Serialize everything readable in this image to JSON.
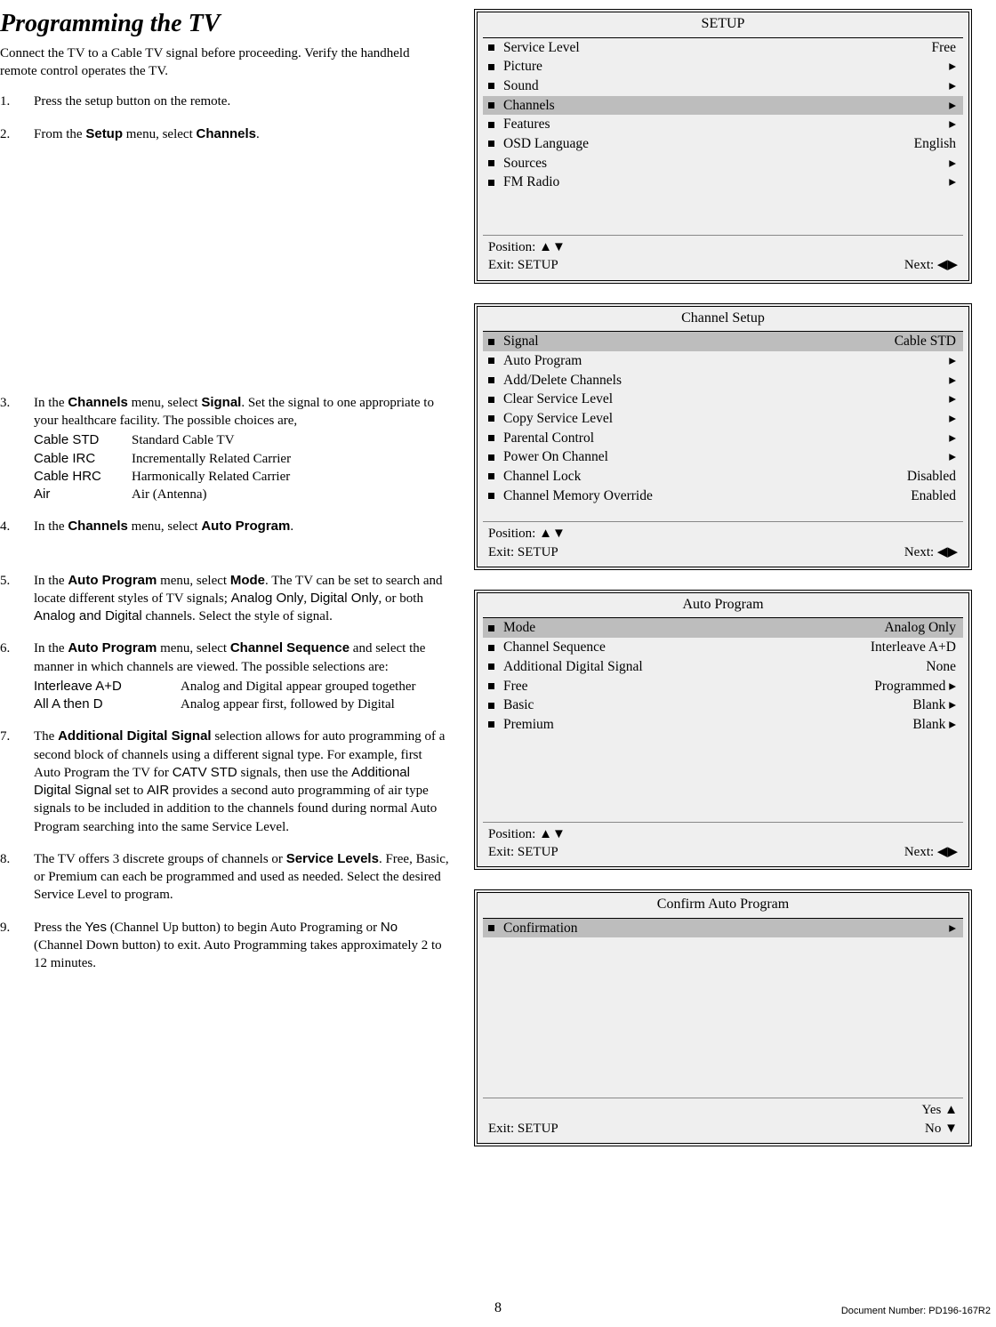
{
  "title": "Programming the TV",
  "intro": "Connect the TV to a Cable TV signal before proceeding.  Verify the handheld remote control operates the TV.",
  "steps": {
    "s1": "Press the setup button on the remote.",
    "s2a": "From the ",
    "s2b": "Setup",
    "s2c": " menu, select ",
    "s2d": "Channels",
    "s2e": ".",
    "s3a": "In the ",
    "s3b": "Channels",
    "s3c": " menu, select ",
    "s3d": "Signal",
    "s3e": ".  Set the signal to one appropriate to your healthcare facility.  The possible choices are,",
    "s3_defs": [
      {
        "t": "Cable STD",
        "d": "Standard Cable TV"
      },
      {
        "t": "Cable IRC",
        "d": "Incrementally Related Carrier"
      },
      {
        "t": "Cable HRC",
        "d": "Harmonically Related Carrier"
      },
      {
        "t": "Air",
        "d": "Air (Antenna)"
      }
    ],
    "s4a": "In the ",
    "s4b": "Channels",
    "s4c": " menu, select ",
    "s4d": "Auto Program",
    "s4e": ".",
    "s5a": "In the ",
    "s5b": "Auto Program",
    "s5c": " menu, select ",
    "s5d": "Mode",
    "s5e": ".  The TV can be set to search and locate different styles of TV signals; ",
    "s5f": "Analog Only",
    "s5g": ", ",
    "s5h": "Digital Only",
    "s5i": ", or both ",
    "s5j": "Analog and Digital",
    "s5k": " channels.  Select the style of signal.",
    "s6a": "In the ",
    "s6b": "Auto Program",
    "s6c": " menu, select ",
    "s6d": "Channel Sequence",
    "s6e": " and select the manner in which channels are viewed.  The possible selections are:",
    "s6_defs": [
      {
        "t": "Interleave A+D",
        "d": "Analog and Digital appear grouped together"
      },
      {
        "t": "All A then D",
        "d": "Analog appear first, followed by Digital"
      }
    ],
    "s7a": "The ",
    "s7b": "Additional Digital Signal",
    "s7c": " selection allows for auto programming of a second block of channels using a different signal type.  For example, first Auto Program the TV for ",
    "s7d": "CATV STD",
    "s7e": " signals, then use the ",
    "s7f": "Additional Digital Signal",
    "s7g": " set to ",
    "s7h": "AIR",
    "s7i": " provides a second auto programming of air type signals to be included in addition to the channels found during normal Auto Program searching into the same Service Level.",
    "s8a": "The TV offers 3 discrete groups of channels or ",
    "s8b": "Service Levels",
    "s8c": ". Free, Basic, or Premium can each be programmed and used as needed.  Select the desired Service Level to program.",
    "s9a": "Press the ",
    "s9b": "Yes",
    "s9c": " (Channel Up button) to begin Auto Programing or ",
    "s9d": "No",
    "s9e": " (Channel Down button) to exit.   Auto Programming takes approximately 2 to 12 minutes."
  },
  "osd": {
    "setup": {
      "title": "SETUP",
      "rows": [
        {
          "l": "Service Level",
          "v": "Free",
          "sel": false
        },
        {
          "l": "Picture",
          "v": "▸",
          "sel": false
        },
        {
          "l": "Sound",
          "v": "▸",
          "sel": false
        },
        {
          "l": "Channels",
          "v": "▸",
          "sel": true
        },
        {
          "l": "Features",
          "v": "▸",
          "sel": false
        },
        {
          "l": "OSD Language",
          "v": "English",
          "sel": false
        },
        {
          "l": "Sources",
          "v": "▸",
          "sel": false
        },
        {
          "l": "FM Radio",
          "v": "▸",
          "sel": false
        }
      ],
      "foot": {
        "pos": "Position: ▲▼",
        "exit": "Exit: SETUP",
        "next": "Next: ◀▶"
      }
    },
    "channel_setup": {
      "title": "Channel Setup",
      "rows": [
        {
          "l": "Signal",
          "v": "Cable STD",
          "sel": true
        },
        {
          "l": "Auto Program",
          "v": "▸",
          "sel": false
        },
        {
          "l": "Add/Delete Channels",
          "v": "▸",
          "sel": false
        },
        {
          "l": "Clear Service Level",
          "v": "▸",
          "sel": false
        },
        {
          "l": "Copy Service Level",
          "v": "▸",
          "sel": false
        },
        {
          "l": "Parental Control",
          "v": "▸",
          "sel": false
        },
        {
          "l": "Power On Channel",
          "v": "▸",
          "sel": false
        },
        {
          "l": "Channel Lock",
          "v": "Disabled",
          "sel": false
        },
        {
          "l": "Channel Memory Override",
          "v": "Enabled",
          "sel": false
        }
      ],
      "foot": {
        "pos": "Position: ▲▼",
        "exit": "Exit: SETUP",
        "next": "Next: ◀▶"
      }
    },
    "auto_program": {
      "title": "Auto Program",
      "rows": [
        {
          "l": "Mode",
          "v": "Analog Only",
          "sel": true
        },
        {
          "l": "Channel Sequence",
          "v": "Interleave A+D",
          "sel": false
        },
        {
          "l": "Additional Digital Signal",
          "v": "None",
          "sel": false
        },
        {
          "l": "Free",
          "v": "Programmed ▸",
          "sel": false
        },
        {
          "l": "Basic",
          "v": "Blank ▸",
          "sel": false
        },
        {
          "l": "Premium",
          "v": "Blank ▸",
          "sel": false
        }
      ],
      "foot": {
        "pos": "Position: ▲▼",
        "exit": "Exit: SETUP",
        "next": "Next: ◀▶"
      }
    },
    "confirm": {
      "title": "Confirm Auto Program",
      "rows": [
        {
          "l": "Confirmation",
          "v": "▸",
          "sel": true
        }
      ],
      "foot": {
        "exit": "Exit: SETUP",
        "yes": "Yes  ▲",
        "no": "No  ▼"
      }
    }
  },
  "pagenum": "8",
  "docnum": "Document Number: PD196-167R2"
}
